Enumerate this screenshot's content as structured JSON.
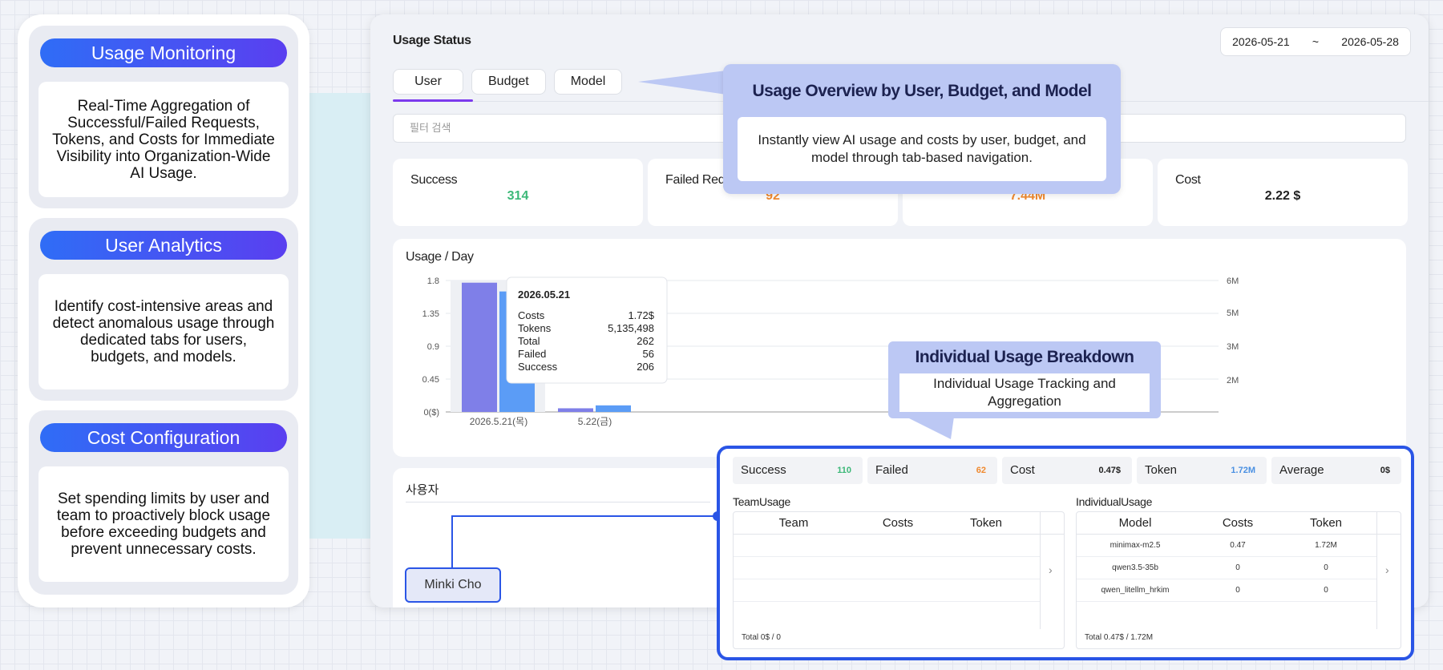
{
  "features": [
    {
      "title": "Usage Monitoring",
      "body": "Real-Time Aggregation of Successful/Failed Requests, Tokens, and Costs for Immediate Visibility into Organization-Wide AI Usage."
    },
    {
      "title": "User Analytics",
      "body": "Identify cost-intensive areas and detect anomalous usage through dedicated tabs for users, budgets, and models."
    },
    {
      "title": "Cost Configuration",
      "body": "Set spending limits by user and team to proactively block usage before exceeding budgets and prevent unnecessary costs."
    }
  ],
  "dashboard": {
    "title": "Usage Status",
    "date_start": "2026-05-21",
    "date_sep": "~",
    "date_end": "2026-05-28",
    "tabs": [
      "User",
      "Budget",
      "Model"
    ],
    "filter_placeholder": "필터 검색",
    "stats": [
      {
        "label": "Success",
        "value": "314",
        "color": "#3cb878"
      },
      {
        "label": "Failed Req",
        "value": "92",
        "color": "#f08a30"
      },
      {
        "label": "",
        "value": "7.44M",
        "color": "#f08a30"
      },
      {
        "label": "Cost",
        "value": "2.22 $",
        "color": "#222222"
      }
    ],
    "chart_title": "Usage / Day",
    "user_label": "사용자",
    "user_chip": "Minki Cho"
  },
  "chart_data": {
    "type": "bar",
    "categories": [
      "2026.5.21(목)",
      "5.22(금)"
    ],
    "y_left_ticks": [
      "1.8",
      "1.35",
      "0.9",
      "0.45",
      "0($)"
    ],
    "y_right_ticks": [
      "6M",
      "5M",
      "3M",
      "2M"
    ],
    "ylim": [
      0,
      1.8
    ],
    "series": [
      {
        "values": [
          1.77,
          0.05
        ],
        "color": "#7f7fe8"
      },
      {
        "values": [
          1.65,
          0.09
        ],
        "color": "#5b9cf6"
      }
    ],
    "extra_bars_visible": [
      {
        "values": [
          0.45,
          0.5
        ]
      }
    ],
    "tooltip": {
      "date": "2026.05.21",
      "rows": [
        {
          "k": "Costs",
          "v": "1.72$"
        },
        {
          "k": "Tokens",
          "v": "5,135,498"
        },
        {
          "k": "Total",
          "v": "262"
        },
        {
          "k": "Failed",
          "v": "56"
        },
        {
          "k": "Success",
          "v": "206"
        }
      ]
    }
  },
  "callouts": {
    "overview_title": "Usage Overview by User, Budget, and Model",
    "overview_body": "Instantly view AI usage and costs by user, budget, and model through tab-based navigation.",
    "indiv_title": "Individual Usage Breakdown",
    "indiv_body": "Individual Usage Tracking and Aggregation"
  },
  "detail": {
    "stats": [
      {
        "label": "Success",
        "value": "110",
        "color": "#3cb878"
      },
      {
        "label": "Failed",
        "value": "62",
        "color": "#f08a30"
      },
      {
        "label": "Cost",
        "value": "0.47$",
        "color": "#222222"
      },
      {
        "label": "Token",
        "value": "1.72M",
        "color": "#4a90e2"
      },
      {
        "label": "Average",
        "value": "0$",
        "color": "#222222"
      }
    ],
    "team_title": "TeamUsage",
    "team_headers": [
      "Team",
      "Costs",
      "Token"
    ],
    "team_total": "Total 0$ / 0",
    "indiv_title": "IndividualUsage",
    "indiv_headers": [
      "Model",
      "Costs",
      "Token"
    ],
    "indiv_rows": [
      [
        "minimax-m2.5",
        "0.47",
        "1.72M"
      ],
      [
        "qwen3.5-35b",
        "0",
        "0"
      ],
      [
        "qwen_litellm_hrkim",
        "0",
        "0"
      ]
    ],
    "indiv_total": "Total 0.47$ / 1.72M",
    "chevron": "›"
  }
}
